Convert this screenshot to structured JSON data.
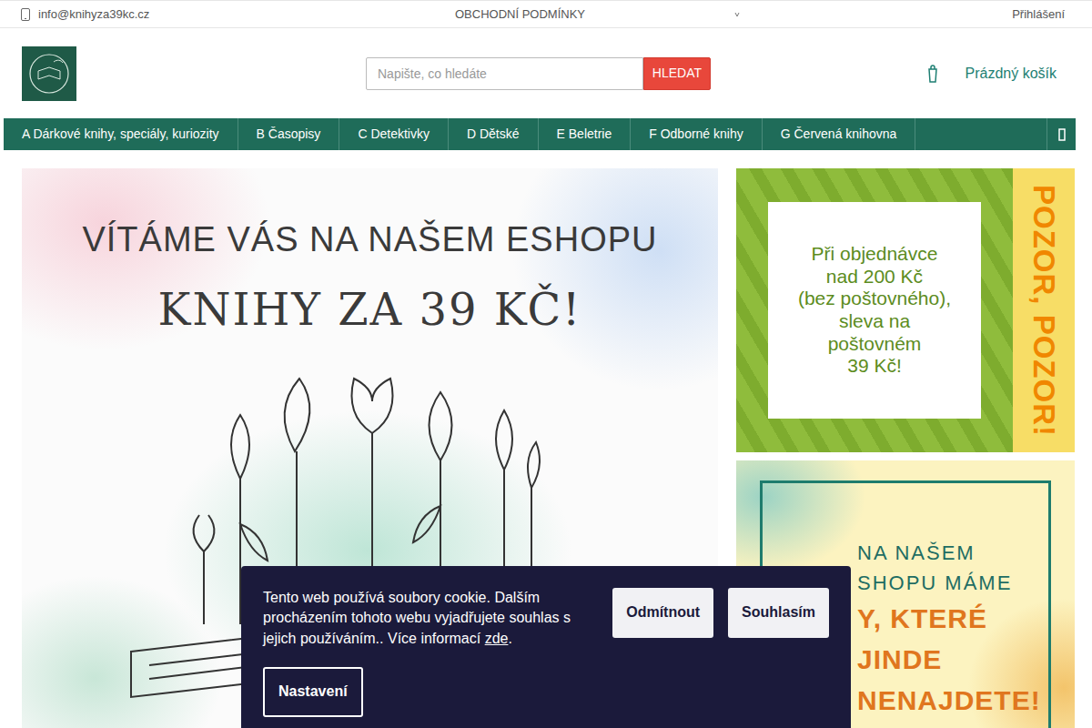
{
  "topbar": {
    "email": "info@knihyza39kc.cz",
    "terms": "OBCHODNÍ PODMÍNKY",
    "login": "Přihlášení"
  },
  "search": {
    "placeholder": "Napište, co hledáte",
    "button": "HLEDAT"
  },
  "cart": {
    "label": "Prázdný košík"
  },
  "menu": {
    "items": [
      "A Dárkové knihy, speciály, kuriozity",
      "B Časopisy",
      "C Detektivky",
      "D Dětské",
      "E Beletrie",
      "F Odborné knihy",
      "G Červená knihovna"
    ]
  },
  "hero": {
    "title": "VÍTÁME VÁS NA NAŠEM ESHOPU",
    "subtitle": "KNIHY ZA 39 KČ!"
  },
  "promo1": {
    "lines": [
      "Při objednávce",
      "nad 200 Kč",
      "(bez poštovného),",
      "sleva na",
      "poštovném",
      "39 Kč!"
    ],
    "side": "POZOR, POZOR!"
  },
  "promo2": {
    "lines": [
      "NA NAŠEM",
      "SHOPU MÁME"
    ],
    "strong": [
      "Y, KTERÉ JINDE",
      "NENAJDETE!"
    ]
  },
  "cookie": {
    "text": "Tento web používá soubory cookie. Dalším procházením tohoto webu vyjadřujete souhlas s jejich používáním.. Více informací ",
    "link": "zde",
    "after": ".",
    "buttons": [
      "Odmítnout",
      "Souhlasím"
    ],
    "settings": "Nastavení"
  }
}
